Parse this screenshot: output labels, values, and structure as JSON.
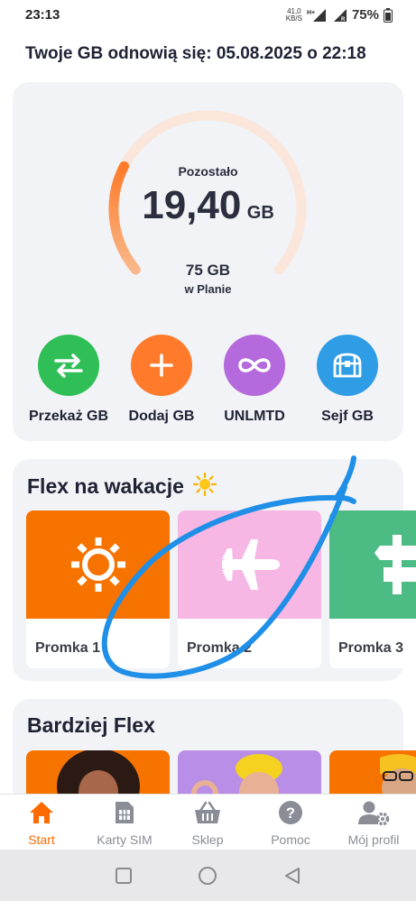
{
  "status": {
    "time": "23:13",
    "net_speed_value": "41,0",
    "net_speed_unit": "KB/S",
    "battery": "75%"
  },
  "renewal_text": "Twoje GB odnowią się: 05.08.2025 o 22:18",
  "gauge": {
    "remaining_label": "Pozostało",
    "remaining_value": "19,40",
    "unit": "GB",
    "plan_value": "75 GB",
    "plan_label": "w Planie",
    "fill_fraction": 0.2587,
    "track_color": "#fae6da",
    "fill_color_start": "#ff7a2a",
    "fill_color_end": "#f9b88a"
  },
  "actions": [
    {
      "label": "Przekaż GB",
      "icon": "transfer-arrows-icon",
      "color": "#2fbf56"
    },
    {
      "label": "Dodaj GB",
      "icon": "plus-icon",
      "color": "#ff7a2a"
    },
    {
      "label": "UNLMTD",
      "icon": "infinity-icon",
      "color": "#b46adc"
    },
    {
      "label": "Sejf GB",
      "icon": "treasure-chest-icon",
      "color": "#2e9de6"
    }
  ],
  "flex_section": {
    "title": "Flex na wakacje",
    "title_icon": "sun-emoji-icon",
    "promos": [
      {
        "label": "Promka 1",
        "icon": "sun-icon",
        "color": "#f67300"
      },
      {
        "label": "Promka 2",
        "icon": "airplane-icon",
        "color": "#f6b7e4"
      },
      {
        "label": "Promka 3",
        "icon": "signpost-icon",
        "color": "#4dbb84"
      }
    ]
  },
  "more_section": {
    "title": "Bardziej Flex"
  },
  "bottom_nav": [
    {
      "label": "Start",
      "icon": "home-icon",
      "active": true
    },
    {
      "label": "Karty SIM",
      "icon": "sim-card-icon",
      "active": false
    },
    {
      "label": "Sklep",
      "icon": "basket-icon",
      "active": false
    },
    {
      "label": "Pomoc",
      "icon": "help-icon",
      "active": false
    },
    {
      "label": "Mój profil",
      "icon": "user-settings-icon",
      "active": false
    }
  ],
  "colors": {
    "accent": "#ff6a00",
    "card_bg": "#f2f3f6",
    "annotation_stroke": "#1f8fe8"
  }
}
